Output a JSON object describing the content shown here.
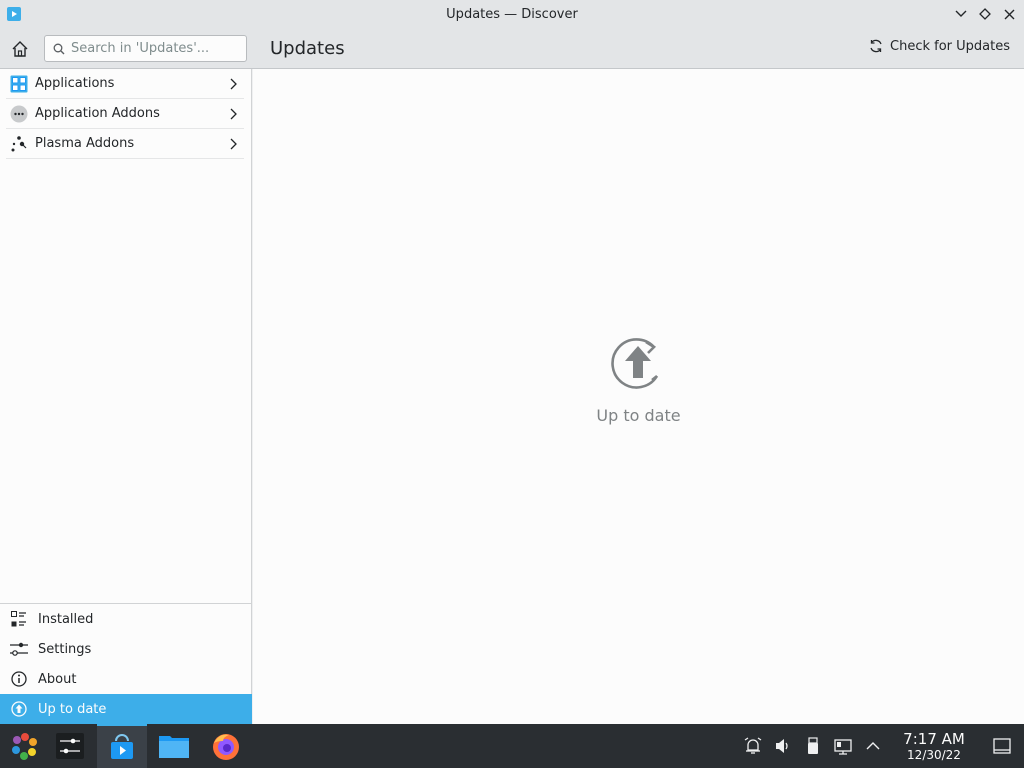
{
  "window": {
    "title": "Updates — Discover"
  },
  "toolbar": {
    "search_placeholder": "Search in 'Updates'...",
    "page_title": "Updates",
    "check_updates_label": "Check for Updates"
  },
  "sidebar": {
    "categories": [
      {
        "label": "Applications",
        "icon": "applications-icon"
      },
      {
        "label": "Application Addons",
        "icon": "addons-icon"
      },
      {
        "label": "Plasma Addons",
        "icon": "plasma-icon"
      }
    ],
    "bottom": [
      {
        "label": "Installed",
        "icon": "installed-icon"
      },
      {
        "label": "Settings",
        "icon": "settings-icon"
      },
      {
        "label": "About",
        "icon": "info-icon"
      },
      {
        "label": "Up to date",
        "icon": "update-icon",
        "active": true
      }
    ]
  },
  "main": {
    "status_text": "Up to date"
  },
  "taskbar": {
    "clock_time": "7:17 AM",
    "clock_date": "12/30/22"
  },
  "colors": {
    "accent": "#3daee9",
    "taskbar": "#2a2e32"
  }
}
